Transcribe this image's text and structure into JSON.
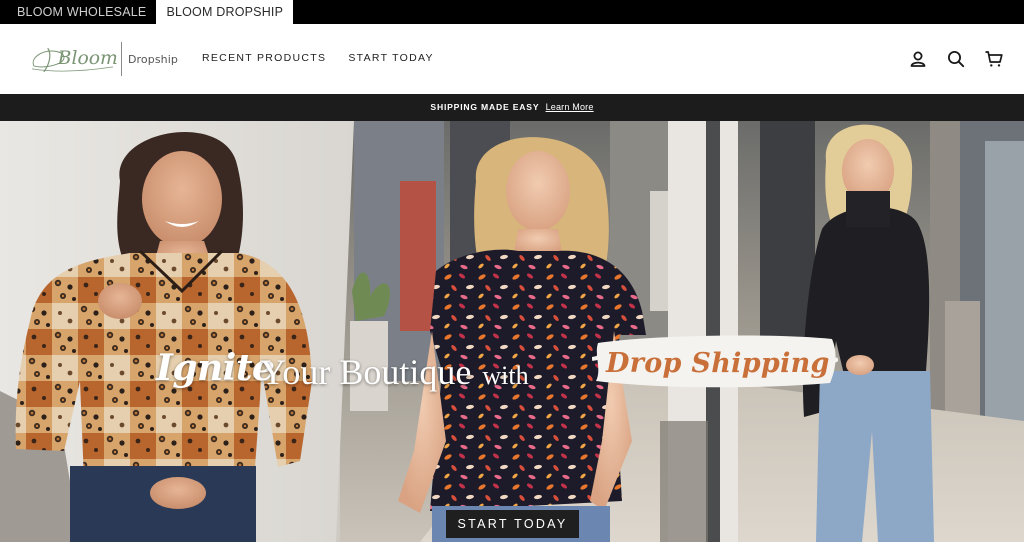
{
  "store_switcher": {
    "tabs": [
      {
        "label": "BLOOM WHOLESALE",
        "active": false
      },
      {
        "label": "BLOOM DROPSHIP",
        "active": true
      }
    ]
  },
  "header": {
    "logo": {
      "script": "Bloom",
      "sub": "Dropship"
    },
    "nav": [
      {
        "label": "RECENT PRODUCTS"
      },
      {
        "label": "START TODAY"
      }
    ],
    "icons": {
      "account": "user-icon",
      "search": "search-icon",
      "cart": "cart-icon"
    }
  },
  "announcement": {
    "text": "SHIPPING MADE EASY",
    "link": "Learn More"
  },
  "hero": {
    "headline": {
      "script_word": "Ignite",
      "middle": "Your Boutique",
      "joiner": "with",
      "highlight": "Drop Shipping"
    },
    "cta_label": "START TODAY",
    "colors": {
      "highlight_text": "#c9703a",
      "cta_background": "#1f1f1f"
    }
  }
}
